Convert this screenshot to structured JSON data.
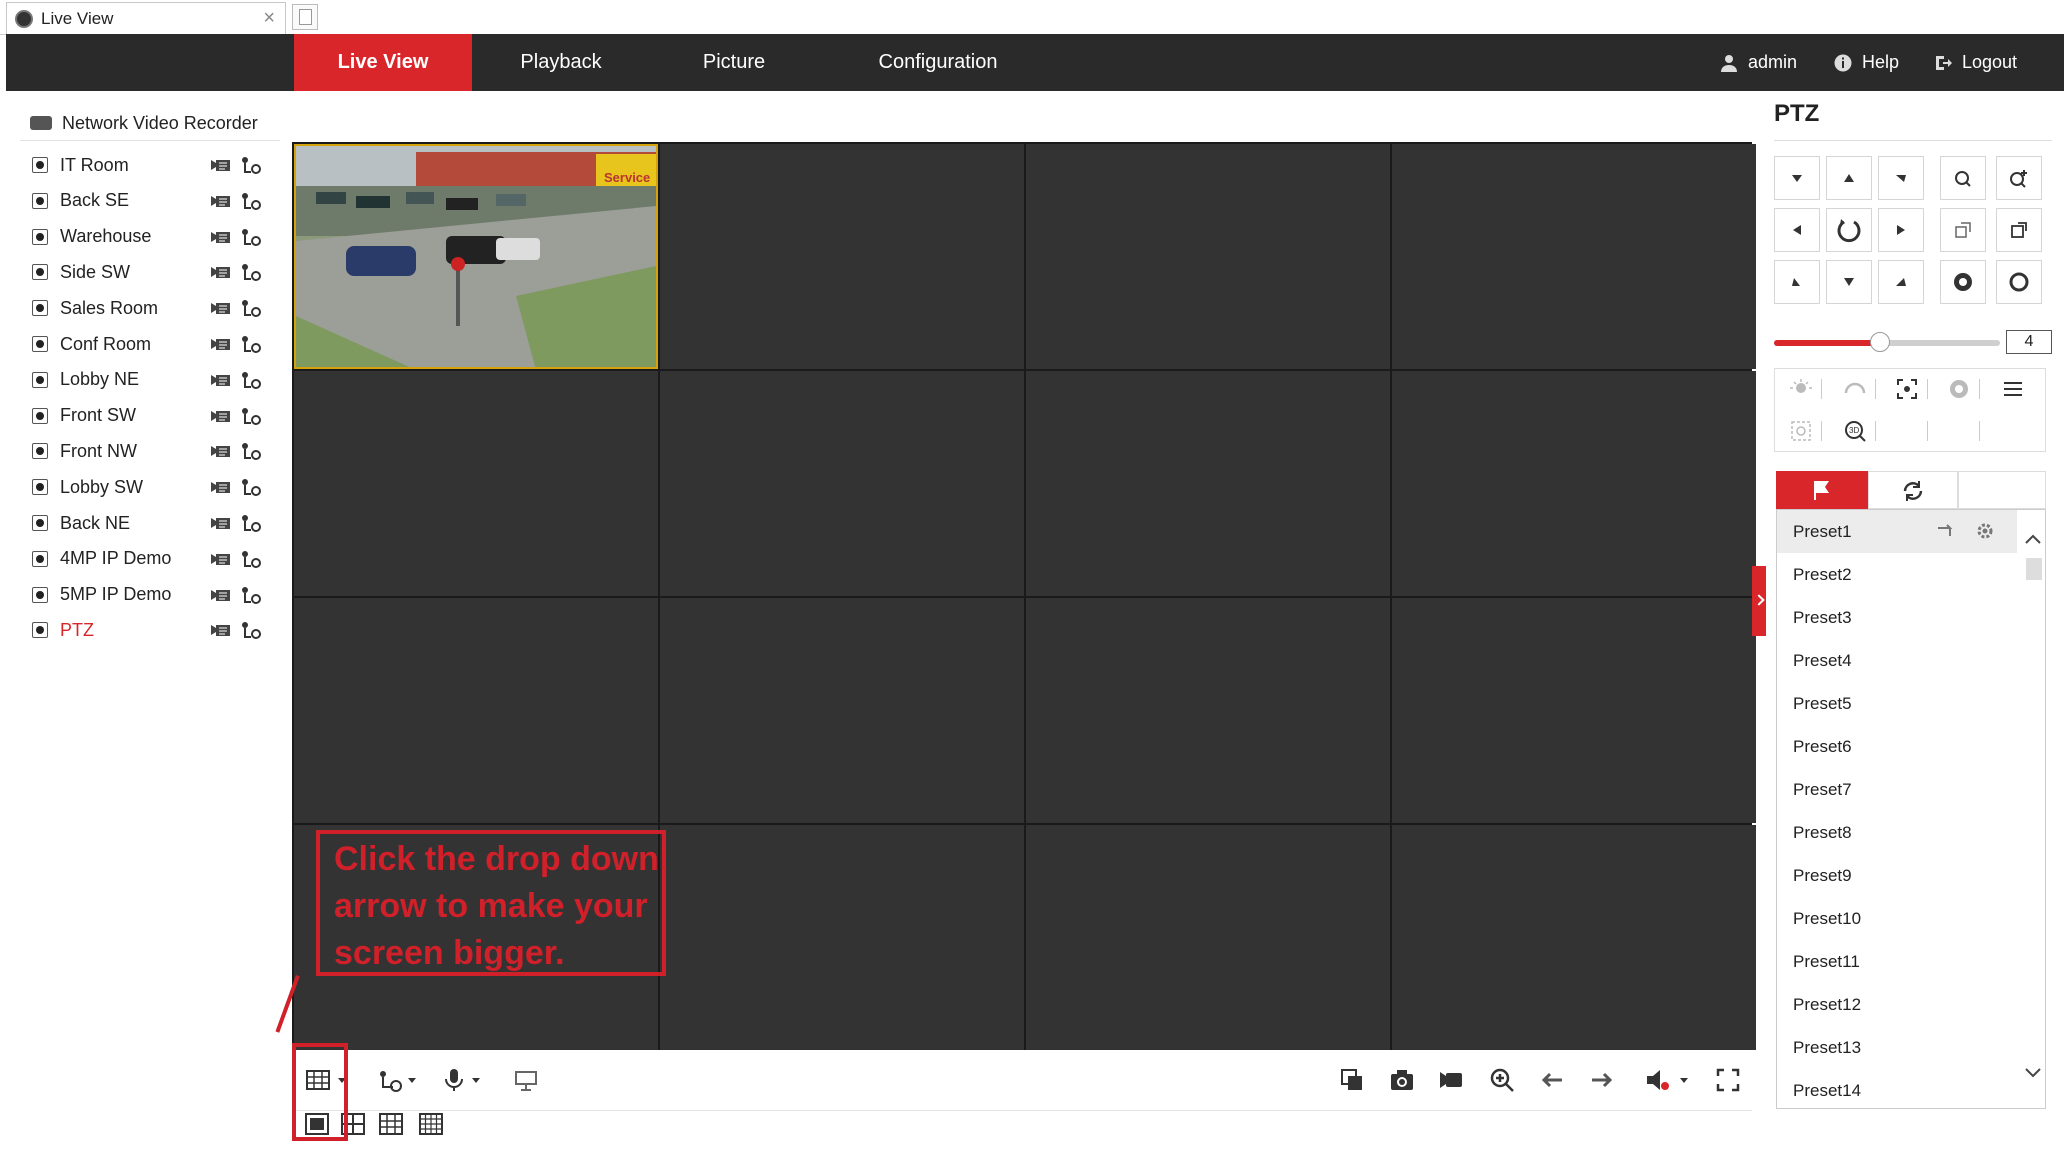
{
  "browser": {
    "tab_title": "Live View",
    "close_glyph": "×"
  },
  "nav": {
    "items": [
      "Live View",
      "Playback",
      "Picture",
      "Configuration"
    ],
    "user": "admin",
    "help": "Help",
    "logout": "Logout"
  },
  "tree": {
    "root": "Network Video Recorder",
    "cameras": [
      "IT Room",
      "Back SE",
      "Warehouse",
      "Side SW",
      "Sales Room",
      "Conf Room",
      "Lobby NE",
      "Front SW",
      "Front NW",
      "Lobby SW",
      "Back NE",
      "4MP IP Demo",
      "5MP IP Demo",
      "PTZ"
    ]
  },
  "video": {
    "camera_sign_text": "Service"
  },
  "annotation": {
    "lines": [
      "Click the drop down",
      "arrow to make your",
      "screen bigger."
    ]
  },
  "ptz": {
    "title": "PTZ",
    "speed_value": "4",
    "speed_fraction": 0.47,
    "presets": [
      "Preset1",
      "Preset2",
      "Preset3",
      "Preset4",
      "Preset5",
      "Preset6",
      "Preset7",
      "Preset8",
      "Preset9",
      "Preset10",
      "Preset11",
      "Preset12",
      "Preset13",
      "Preset14"
    ]
  },
  "colors": {
    "accent": "#d8262b",
    "nav_bg": "#2a2a2a",
    "cell_bg": "#333333",
    "selected_border": "#d4a20c"
  }
}
